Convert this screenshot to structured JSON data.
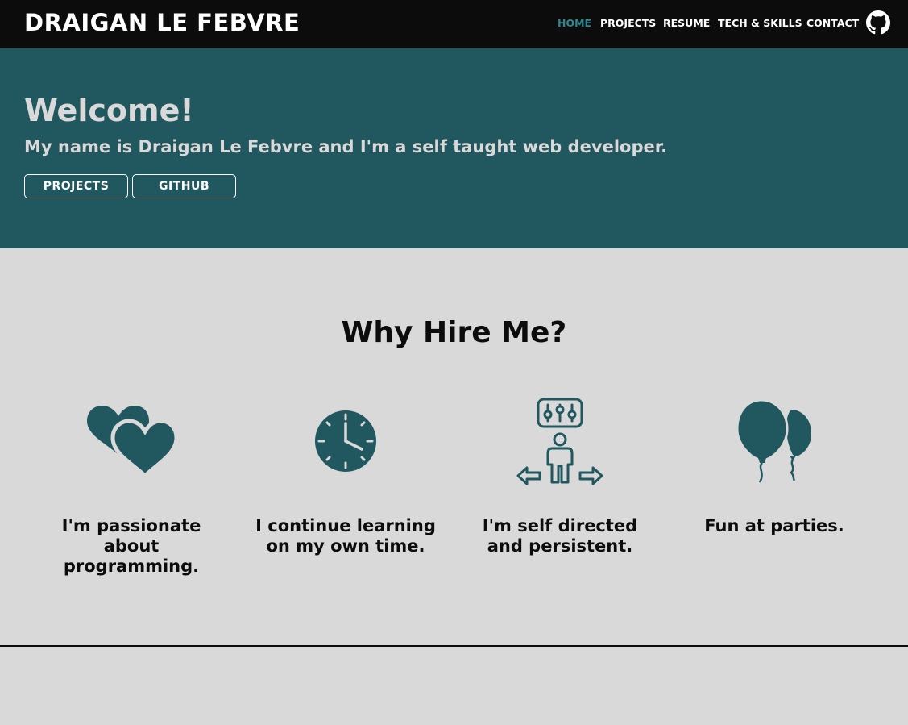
{
  "brand": "DRAIGAN LE FEBVRE",
  "nav": {
    "home": "HOME",
    "projects": "PROJECTS",
    "resume": "RESUME",
    "tech": "TECH & SKILLS",
    "contact": "CONTACT",
    "github_icon": "github-icon"
  },
  "hero": {
    "title": "Welcome!",
    "subtitle": "My name is Draigan Le Febvre and I'm a self taught web developer.",
    "projects_btn": "PROJECTS",
    "github_btn": "GITHUB"
  },
  "why": {
    "title": "Why Hire Me?",
    "features": [
      {
        "icon": "hearts-icon",
        "text": "I'm passionate about programming."
      },
      {
        "icon": "clock-icon",
        "text": "I continue learning on my own time."
      },
      {
        "icon": "self-directed-icon",
        "text": "I'm self directed and persistent."
      },
      {
        "icon": "balloons-icon",
        "text": "Fun at parties."
      }
    ]
  },
  "colors": {
    "navbar": "#0c0c0c",
    "hero": "#21575f",
    "accent": "#2a8a91",
    "background": "#d9d9d9",
    "icon": "#21575f"
  }
}
